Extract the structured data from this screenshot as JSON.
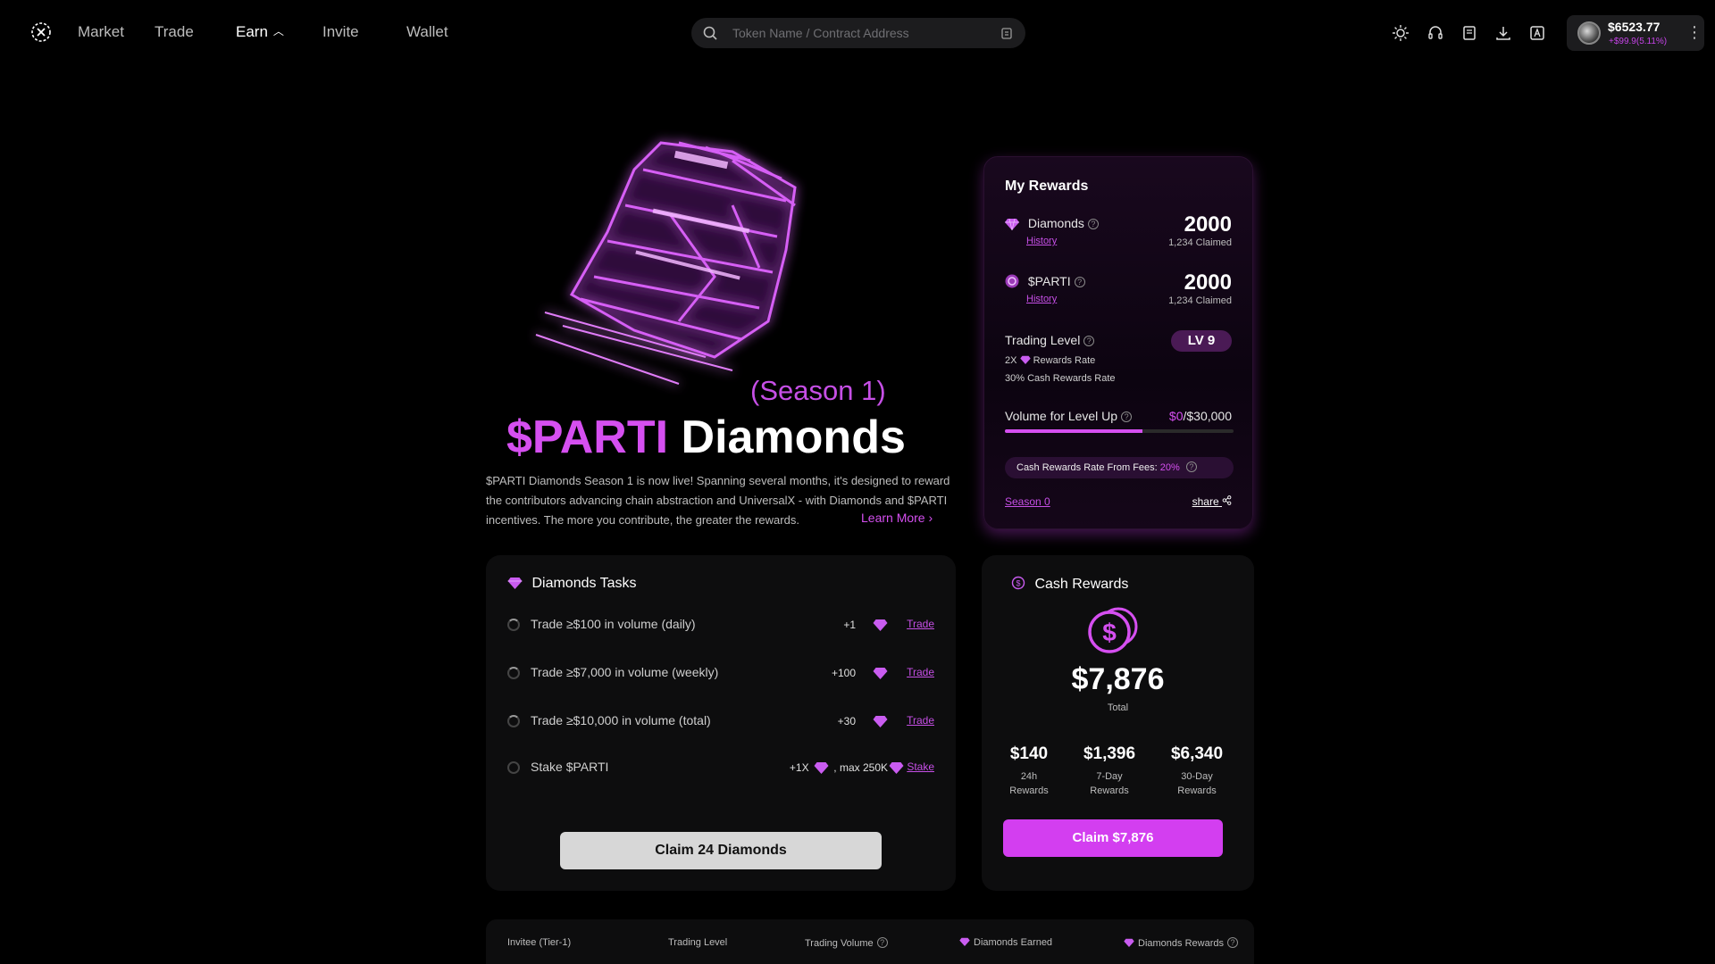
{
  "nav": {
    "links": [
      "Market",
      "Trade",
      "Earn",
      "Invite",
      "Wallet"
    ],
    "active": "Earn",
    "search_placeholder": "Token Name / Contract Address",
    "account": {
      "balance": "$6523.77",
      "change": "+$99.9(5.11%)"
    },
    "icons": [
      "sun-icon",
      "headset-icon",
      "document-icon",
      "download-icon",
      "translate-icon"
    ]
  },
  "hero": {
    "season": "(Season 1)",
    "title_highlight": "$PARTI",
    "title_rest": "Diamonds",
    "description": "$PARTI Diamonds Season 1 is now live! Spanning several months, it's designed to reward the contributors advancing chain abstraction and UniversalX - with Diamonds and $PARTI incentives. The more you contribute, the greater the rewards.",
    "learn_more": "Learn More"
  },
  "my_rewards": {
    "title": "My Rewards",
    "diamonds": {
      "label": "Diamonds",
      "history": "History",
      "value": "2000",
      "claimed": "1,234 Claimed"
    },
    "parti": {
      "label": "$PARTI",
      "history": "History",
      "value": "2000",
      "claimed": "1,234 Claimed"
    },
    "trading_level": {
      "label": "Trading Level",
      "badge": "LV 9",
      "rate_multiplier": "2X",
      "rate_suffix": "Rewards Rate",
      "cash_rate": "30% Cash Rewards Rate"
    },
    "volume": {
      "label": "Volume for Level Up",
      "current": "$0",
      "target": "/$30,000",
      "progress": 0.6
    },
    "fee": {
      "label": "Cash Rewards Rate From Fees:",
      "value": "20%"
    },
    "season0": "Season 0",
    "share": "share"
  },
  "tasks": {
    "title": "Diamonds Tasks",
    "items": [
      {
        "label": "Trade ≥$100 in volume (daily)",
        "points": "+1",
        "action": "Trade"
      },
      {
        "label": "Trade ≥$7,000 in volume (weekly)",
        "points": "+100",
        "action": "Trade"
      },
      {
        "label": "Trade ≥$10,000 in volume (total)",
        "points": "+30",
        "action": "Trade"
      },
      {
        "label": "Stake $PARTI",
        "points": "+1X",
        "extra": ", max 250K",
        "action": "Stake"
      }
    ],
    "claim": {
      "prefix": "Claim",
      "count": "24",
      "suffix": "Diamonds"
    }
  },
  "cash": {
    "title": "Cash Rewards",
    "total": "$7,876",
    "total_label": "Total",
    "stats": [
      {
        "value": "$140",
        "label1": "24h",
        "label2": "Rewards"
      },
      {
        "value": "$1,396",
        "label1": "7-Day",
        "label2": "Rewards"
      },
      {
        "value": "$6,340",
        "label1": "30-Day",
        "label2": "Rewards"
      }
    ],
    "claim": "Claim $7,876"
  },
  "table": {
    "headers": [
      "Invitee (Tier-1)",
      "Trading Level",
      "Trading Volume",
      "Diamonds Earned",
      "Diamonds Rewards"
    ]
  },
  "colors": {
    "accent": "#d54ff0",
    "bg": "#000000",
    "card": "#0d0d0e"
  }
}
